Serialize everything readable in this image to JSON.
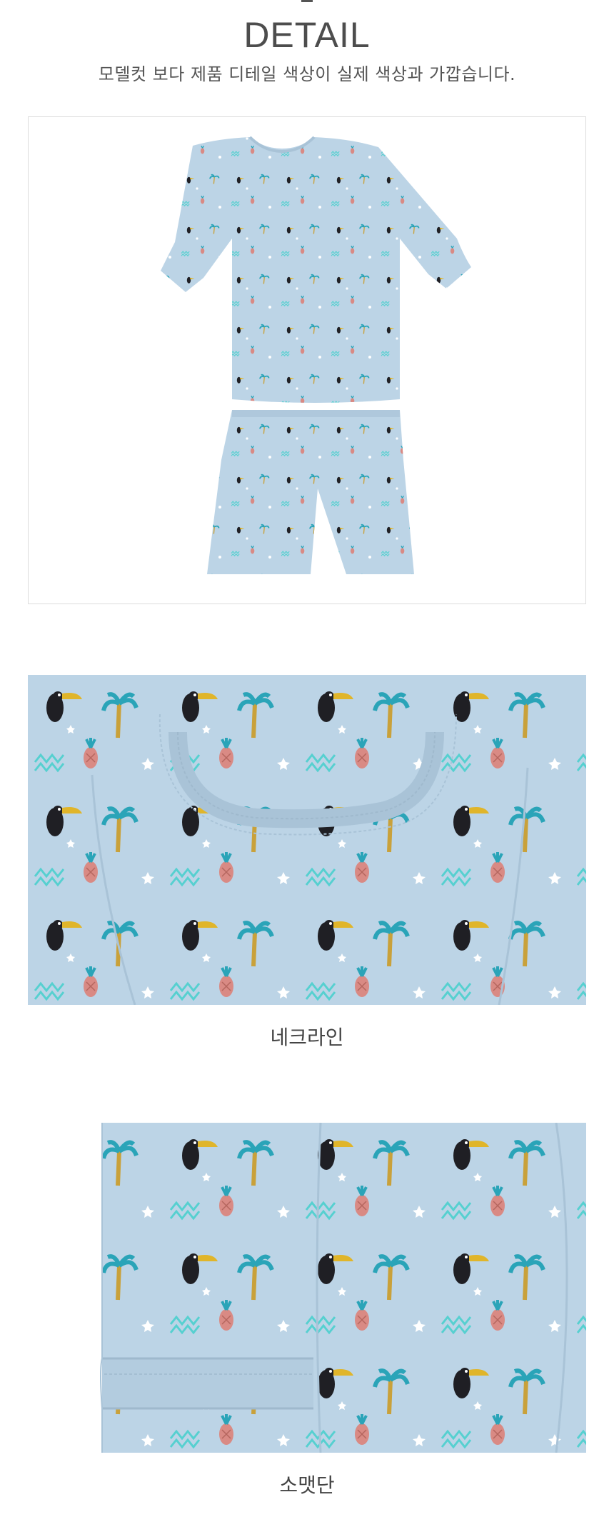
{
  "header": {
    "title": "DETAIL",
    "subtitle": "모델컷 보다 제품 디테일 색상이 실제 색상과 가깝습니다."
  },
  "sections": [
    {
      "caption": ""
    },
    {
      "caption": "네크라인"
    },
    {
      "caption": "소맷단"
    }
  ],
  "colors": {
    "fabric": "#bcd4e6",
    "fabric_shadow": "#a9c3d7",
    "toucan_black": "#1f1f24",
    "beak_yellow": "#e0b52a",
    "pineapple_pink": "#d98a84",
    "leaf_teal": "#2aa4b8",
    "zigzag_cyan": "#56d0d0",
    "star_white": "#ffffff"
  }
}
